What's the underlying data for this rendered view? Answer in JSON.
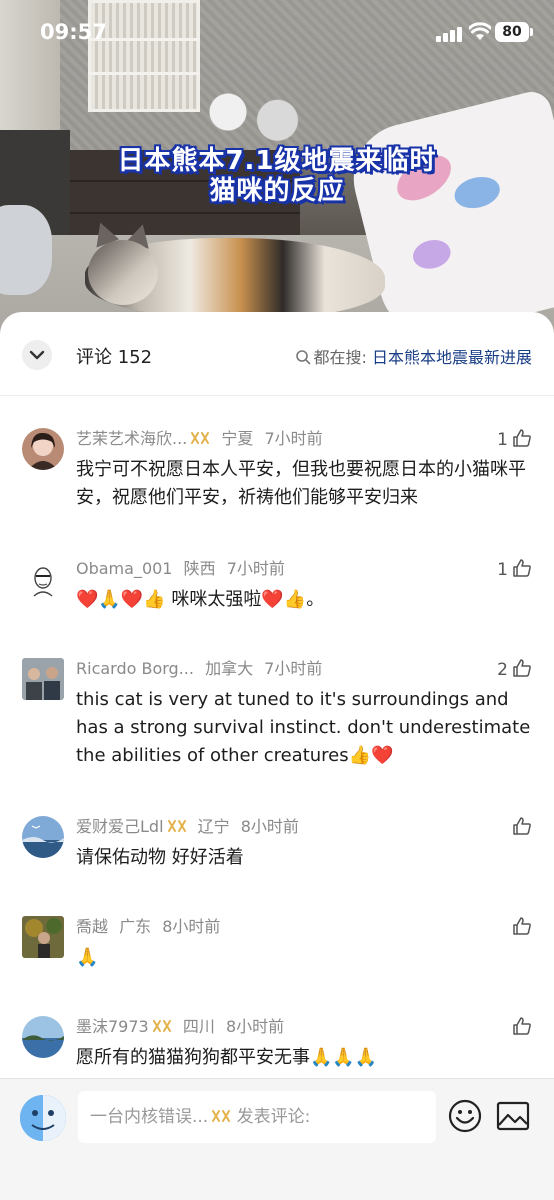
{
  "status_bar": {
    "time": "09:57",
    "battery": "80"
  },
  "video": {
    "caption_line1": "日本熊本7.1级地震来临时",
    "caption_line2": "猫咪的反应"
  },
  "comments_header": {
    "title": "评论 152",
    "search_prefix": "都在搜:",
    "search_keyword": "日本熊本地震最新进展"
  },
  "comments": [
    {
      "user": "艺茉艺术海欣...",
      "badge": true,
      "location": "宁夏",
      "time": "7小时前",
      "likes": "1",
      "text": "我宁可不祝愿日本人平安，但我也要祝愿日本的小猫咪平安，祝愿他们平安，祈祷他们能够平安归来"
    },
    {
      "user": "Obama_001",
      "badge": false,
      "location": "陕西",
      "time": "7小时前",
      "likes": "1",
      "text": "❤️🙏❤️👍  咪咪太强啦❤️👍。"
    },
    {
      "user": "Ricardo Borg...",
      "badge": false,
      "location": "加拿大",
      "time": "7小时前",
      "likes": "2",
      "text": "this cat is very at tuned to it's surroundings and has a strong survival instinct. don't underestimate the abilities of other creatures👍❤️"
    },
    {
      "user": "爱财爱己Ldl",
      "badge": true,
      "location": "辽宁",
      "time": "8小时前",
      "likes": "",
      "text": "请保佑动物 好好活着"
    },
    {
      "user": "喬越",
      "badge": false,
      "location": "广东",
      "time": "8小时前",
      "likes": "",
      "text": "🙏"
    },
    {
      "user": "墨沫7973",
      "badge": true,
      "location": "四川",
      "time": "8小时前",
      "likes": "",
      "text": "愿所有的猫猫狗狗都平安无事🙏🙏🙏"
    }
  ],
  "input_bar": {
    "username": "一台内核错误...",
    "placeholder": "发表评论:"
  },
  "colors": {
    "caption_outline": "#1832a8",
    "search_keyword": "#1a3e86",
    "badge": "#e3b24a"
  }
}
